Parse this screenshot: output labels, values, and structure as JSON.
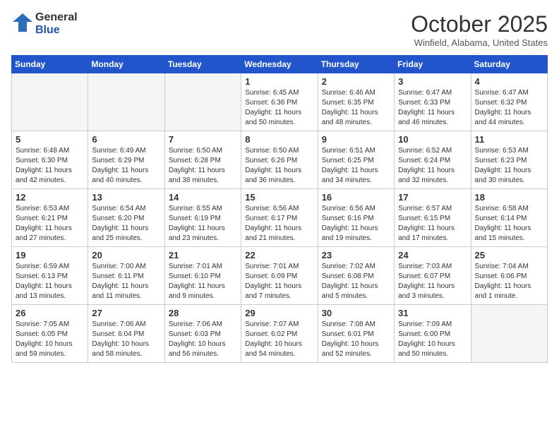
{
  "header": {
    "logo_general": "General",
    "logo_blue": "Blue",
    "month_title": "October 2025",
    "subtitle": "Winfield, Alabama, United States"
  },
  "weekdays": [
    "Sunday",
    "Monday",
    "Tuesday",
    "Wednesday",
    "Thursday",
    "Friday",
    "Saturday"
  ],
  "weeks": [
    [
      {
        "day": "",
        "info": ""
      },
      {
        "day": "",
        "info": ""
      },
      {
        "day": "",
        "info": ""
      },
      {
        "day": "1",
        "info": "Sunrise: 6:45 AM\nSunset: 6:36 PM\nDaylight: 11 hours\nand 50 minutes."
      },
      {
        "day": "2",
        "info": "Sunrise: 6:46 AM\nSunset: 6:35 PM\nDaylight: 11 hours\nand 48 minutes."
      },
      {
        "day": "3",
        "info": "Sunrise: 6:47 AM\nSunset: 6:33 PM\nDaylight: 11 hours\nand 46 minutes."
      },
      {
        "day": "4",
        "info": "Sunrise: 6:47 AM\nSunset: 6:32 PM\nDaylight: 11 hours\nand 44 minutes."
      }
    ],
    [
      {
        "day": "5",
        "info": "Sunrise: 6:48 AM\nSunset: 6:30 PM\nDaylight: 11 hours\nand 42 minutes."
      },
      {
        "day": "6",
        "info": "Sunrise: 6:49 AM\nSunset: 6:29 PM\nDaylight: 11 hours\nand 40 minutes."
      },
      {
        "day": "7",
        "info": "Sunrise: 6:50 AM\nSunset: 6:28 PM\nDaylight: 11 hours\nand 38 minutes."
      },
      {
        "day": "8",
        "info": "Sunrise: 6:50 AM\nSunset: 6:26 PM\nDaylight: 11 hours\nand 36 minutes."
      },
      {
        "day": "9",
        "info": "Sunrise: 6:51 AM\nSunset: 6:25 PM\nDaylight: 11 hours\nand 34 minutes."
      },
      {
        "day": "10",
        "info": "Sunrise: 6:52 AM\nSunset: 6:24 PM\nDaylight: 11 hours\nand 32 minutes."
      },
      {
        "day": "11",
        "info": "Sunrise: 6:53 AM\nSunset: 6:23 PM\nDaylight: 11 hours\nand 30 minutes."
      }
    ],
    [
      {
        "day": "12",
        "info": "Sunrise: 6:53 AM\nSunset: 6:21 PM\nDaylight: 11 hours\nand 27 minutes."
      },
      {
        "day": "13",
        "info": "Sunrise: 6:54 AM\nSunset: 6:20 PM\nDaylight: 11 hours\nand 25 minutes."
      },
      {
        "day": "14",
        "info": "Sunrise: 6:55 AM\nSunset: 6:19 PM\nDaylight: 11 hours\nand 23 minutes."
      },
      {
        "day": "15",
        "info": "Sunrise: 6:56 AM\nSunset: 6:17 PM\nDaylight: 11 hours\nand 21 minutes."
      },
      {
        "day": "16",
        "info": "Sunrise: 6:56 AM\nSunset: 6:16 PM\nDaylight: 11 hours\nand 19 minutes."
      },
      {
        "day": "17",
        "info": "Sunrise: 6:57 AM\nSunset: 6:15 PM\nDaylight: 11 hours\nand 17 minutes."
      },
      {
        "day": "18",
        "info": "Sunrise: 6:58 AM\nSunset: 6:14 PM\nDaylight: 11 hours\nand 15 minutes."
      }
    ],
    [
      {
        "day": "19",
        "info": "Sunrise: 6:59 AM\nSunset: 6:13 PM\nDaylight: 11 hours\nand 13 minutes."
      },
      {
        "day": "20",
        "info": "Sunrise: 7:00 AM\nSunset: 6:11 PM\nDaylight: 11 hours\nand 11 minutes."
      },
      {
        "day": "21",
        "info": "Sunrise: 7:01 AM\nSunset: 6:10 PM\nDaylight: 11 hours\nand 9 minutes."
      },
      {
        "day": "22",
        "info": "Sunrise: 7:01 AM\nSunset: 6:09 PM\nDaylight: 11 hours\nand 7 minutes."
      },
      {
        "day": "23",
        "info": "Sunrise: 7:02 AM\nSunset: 6:08 PM\nDaylight: 11 hours\nand 5 minutes."
      },
      {
        "day": "24",
        "info": "Sunrise: 7:03 AM\nSunset: 6:07 PM\nDaylight: 11 hours\nand 3 minutes."
      },
      {
        "day": "25",
        "info": "Sunrise: 7:04 AM\nSunset: 6:06 PM\nDaylight: 11 hours\nand 1 minute."
      }
    ],
    [
      {
        "day": "26",
        "info": "Sunrise: 7:05 AM\nSunset: 6:05 PM\nDaylight: 10 hours\nand 59 minutes."
      },
      {
        "day": "27",
        "info": "Sunrise: 7:06 AM\nSunset: 6:04 PM\nDaylight: 10 hours\nand 58 minutes."
      },
      {
        "day": "28",
        "info": "Sunrise: 7:06 AM\nSunset: 6:03 PM\nDaylight: 10 hours\nand 56 minutes."
      },
      {
        "day": "29",
        "info": "Sunrise: 7:07 AM\nSunset: 6:02 PM\nDaylight: 10 hours\nand 54 minutes."
      },
      {
        "day": "30",
        "info": "Sunrise: 7:08 AM\nSunset: 6:01 PM\nDaylight: 10 hours\nand 52 minutes."
      },
      {
        "day": "31",
        "info": "Sunrise: 7:09 AM\nSunset: 6:00 PM\nDaylight: 10 hours\nand 50 minutes."
      },
      {
        "day": "",
        "info": ""
      }
    ]
  ]
}
